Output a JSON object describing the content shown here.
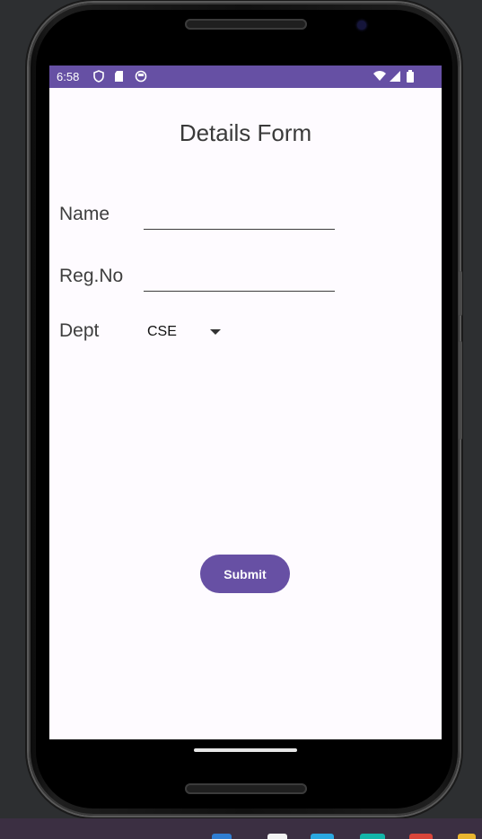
{
  "status_bar": {
    "time": "6:58",
    "left_icons": [
      "shield-icon",
      "sd-card-icon",
      "circle-face-icon"
    ],
    "right_icons": [
      "wifi-icon",
      "cell-signal-icon",
      "battery-icon"
    ],
    "background_color": "#6650a4"
  },
  "form": {
    "title": "Details Form",
    "fields": [
      {
        "label": "Name",
        "value": "",
        "placeholder": ""
      },
      {
        "label": "Reg.No",
        "value": "",
        "placeholder": ""
      }
    ],
    "dept": {
      "label": "Dept",
      "selected": "CSE"
    },
    "submit_label": "Submit",
    "accent_color": "#6750a4",
    "background_color": "#fefbff"
  }
}
